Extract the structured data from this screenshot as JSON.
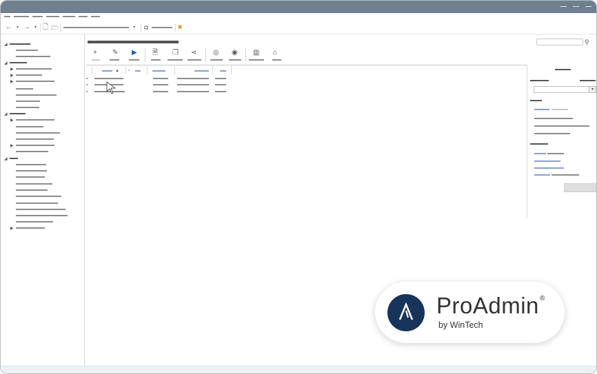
{
  "window": {
    "controls": [
      "minimize",
      "maximize",
      "close"
    ]
  },
  "toolbar": {
    "back_icon": "arrow-left-icon",
    "forward_icon": "arrow-right-icon",
    "new_icon": "document-icon",
    "open_icon": "folder-open-icon"
  },
  "brand": {
    "name": "ProAdmin",
    "registered": "®",
    "tagline": "by WinTech",
    "color": "#17345b"
  },
  "colors": {
    "titlebar": "#6f7f8f",
    "link": "#8a9fd0",
    "selected_icon": "#1d5fa8"
  }
}
